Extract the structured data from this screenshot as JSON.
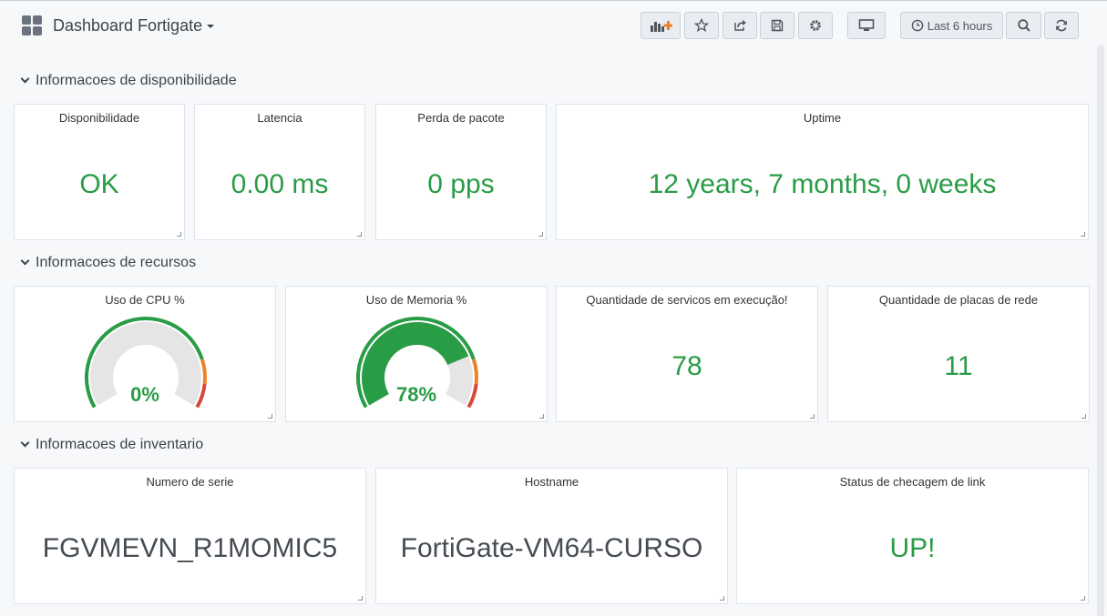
{
  "header": {
    "title": "Dashboard Fortigate",
    "time_range": "Last 6 hours"
  },
  "rows": [
    {
      "title": "Informacoes de disponibilidade"
    },
    {
      "title": "Informacoes de recursos"
    },
    {
      "title": "Informacoes de inventario"
    }
  ],
  "panels": {
    "disponibilidade": {
      "title": "Disponibilidade",
      "value": "OK"
    },
    "latencia": {
      "title": "Latencia",
      "value": "0.00 ms"
    },
    "perda": {
      "title": "Perda de pacote",
      "value": "0 pps"
    },
    "uptime": {
      "title": "Uptime",
      "value": "12 years, 7 months, 0 weeks"
    },
    "cpu": {
      "title": "Uso de CPU %",
      "value": "0%",
      "percent": 0
    },
    "memoria": {
      "title": "Uso de Memoria %",
      "value": "78%",
      "percent": 78
    },
    "servicos": {
      "title": "Quantidade de servicos em execução!",
      "value": "78"
    },
    "placas": {
      "title": "Quantidade de placas de rede",
      "value": "11"
    },
    "serie": {
      "title": "Numero de serie",
      "value": "FGVMEVN_R1MOMIC5"
    },
    "hostname": {
      "title": "Hostname",
      "value": "FortiGate-VM64-CURSO"
    },
    "link": {
      "title": "Status de checagem de link",
      "value": "UP!"
    }
  },
  "colors": {
    "ok_green": "#299c46",
    "warn_orange": "#ed8128",
    "crit_red": "#d44a3a"
  }
}
